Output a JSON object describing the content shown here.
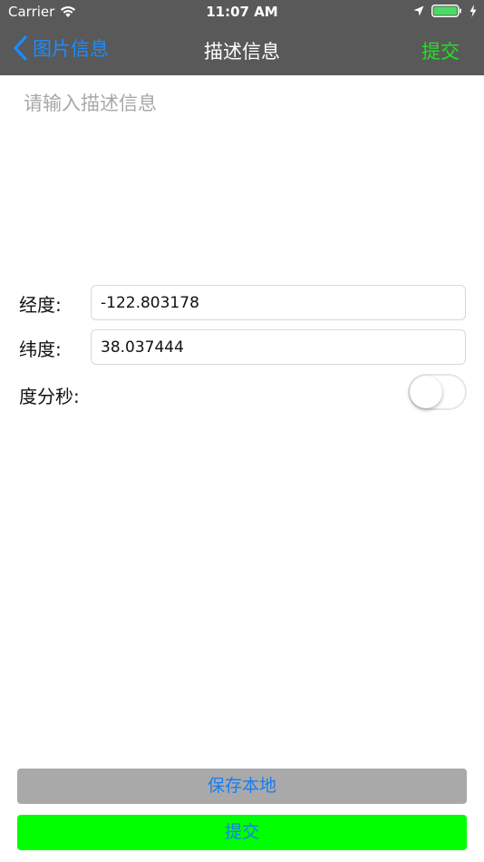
{
  "status_bar": {
    "carrier": "Carrier",
    "time": "11:07 AM",
    "battery_color": "#4cd964"
  },
  "nav": {
    "back_label": "图片信息",
    "title": "描述信息",
    "submit_label": "提交",
    "back_color": "#1a8cff",
    "submit_color": "#22e022"
  },
  "form": {
    "description_placeholder": "请输入描述信息",
    "description_value": "",
    "longitude_label": "经度:",
    "longitude_value": "-122.803178",
    "latitude_label": "纬度:",
    "latitude_value": "38.037444",
    "dms_label": "度分秒:",
    "dms_toggle_on": false
  },
  "buttons": {
    "save_local": "保存本地",
    "submit": "提交"
  }
}
